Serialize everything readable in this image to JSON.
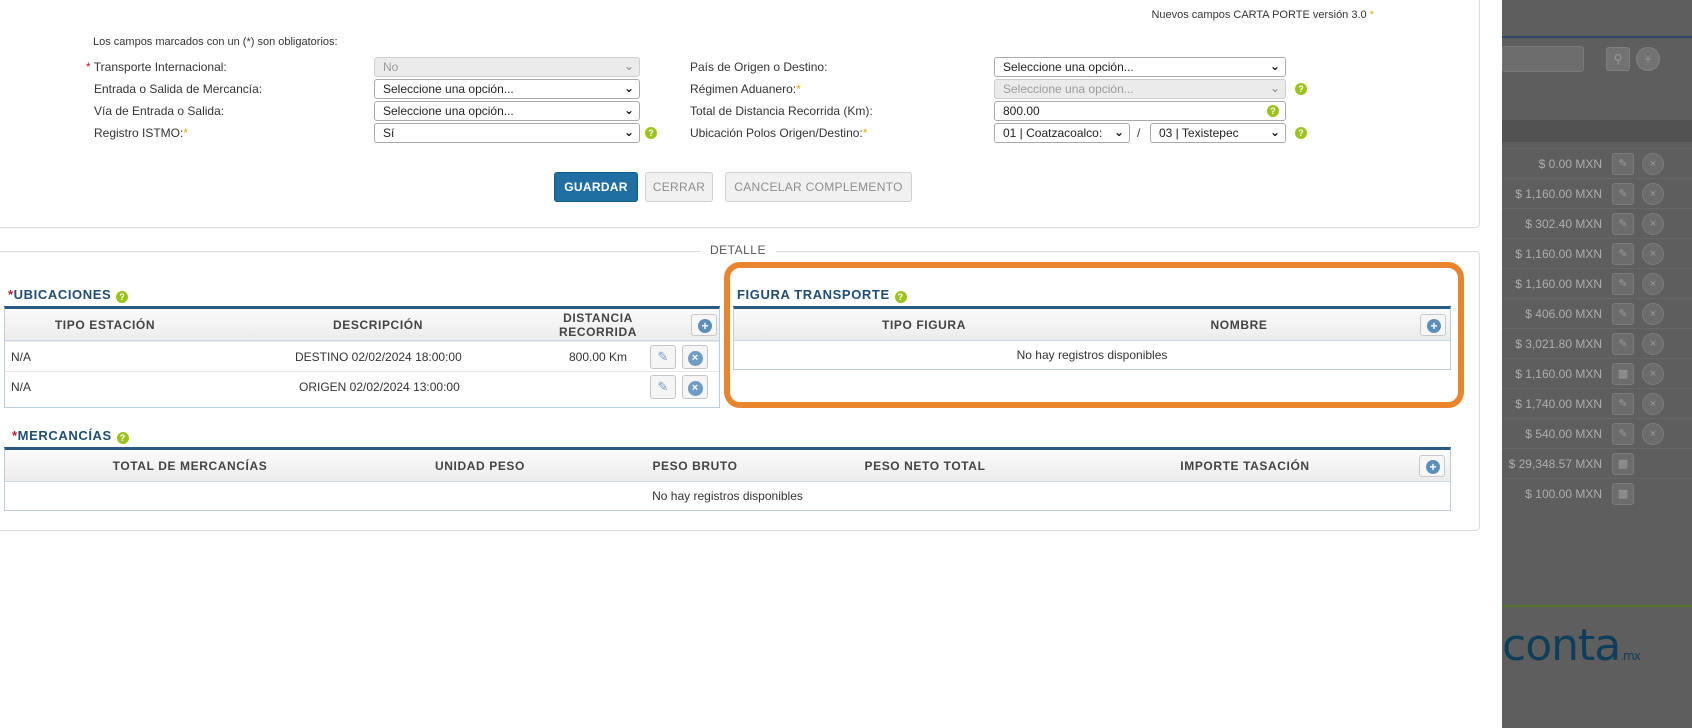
{
  "top": {
    "version_note": "Nuevos campos CARTA PORTE versión 3.0",
    "required_note": "Los campos marcados con un (*) son obligatorios:",
    "fields_left": [
      {
        "label": "Transporte Internacional:",
        "value": "No",
        "required": true,
        "disabled": true
      },
      {
        "label": "Entrada o Salida de Mercancía:",
        "value": "Seleccione una opción...",
        "required": false,
        "disabled": false
      },
      {
        "label": "Vía de Entrada o Salida:",
        "value": "Seleccione una opción...",
        "required": false,
        "disabled": false
      },
      {
        "label": "Registro ISTMO:",
        "value": "Sí",
        "required": true,
        "disabled": false
      }
    ],
    "fields_right": [
      {
        "label": "País de Origen o Destino:",
        "value": "Seleccione una opción...",
        "disabled": false
      },
      {
        "label": "Régimen Aduanero:",
        "value": "Seleccione una opción...",
        "disabled": true
      },
      {
        "label": "Total de Distancia Recorrida (Km):",
        "value": "800.00"
      },
      {
        "label": "Ubicación Polos Origen/Destino:",
        "origen": "01 | Coatzacoalco:",
        "separator": "/",
        "destino": "03 | Texistepec"
      }
    ],
    "buttons": {
      "guardar": "GUARDAR",
      "cerrar": "CERRAR",
      "cancelar": "CANCELAR COMPLEMENTO"
    }
  },
  "detalle": {
    "legend": "DETALLE",
    "ubicaciones": {
      "title": "UBICACIONES",
      "columns": [
        "TIPO ESTACIÓN",
        "DESCRIPCIÓN",
        "DISTANCIA RECORRIDA"
      ],
      "rows": [
        {
          "tipo": "N/A",
          "descripcion": "DESTINO 02/02/2024 18:00:00",
          "distancia": "800.00 Km"
        },
        {
          "tipo": "N/A",
          "descripcion": "ORIGEN 02/02/2024 13:00:00",
          "distancia": ""
        }
      ]
    },
    "figura": {
      "title": "FIGURA TRANSPORTE",
      "columns": [
        "TIPO FIGURA",
        "NOMBRE"
      ],
      "empty": "No hay registros disponibles"
    },
    "mercancias": {
      "title": "MERCANCÍAS",
      "columns": [
        "TOTAL DE MERCANCÍAS",
        "UNIDAD PESO",
        "PESO BRUTO",
        "PESO NETO TOTAL",
        "IMPORTE TASACIÓN"
      ],
      "empty": "No hay registros disponibles"
    }
  },
  "background": {
    "amounts": [
      "$ 0.00 MXN",
      "$ 1,160.00 MXN",
      "$ 302.40 MXN",
      "$ 1,160.00 MXN",
      "$ 1,160.00 MXN",
      "$ 406.00 MXN",
      "$ 3,021.80 MXN",
      "$ 1,160.00 MXN",
      "$ 1,740.00 MXN",
      "$ 540.00 MXN",
      "$ 29,348.57 MXN",
      "$ 100.00 MXN"
    ],
    "logo": "conta",
    "logo_suffix": ".mx"
  },
  "colors": {
    "accent": "#1f6fa3",
    "header_line": "#2a5a7f",
    "help": "#9cc31a",
    "highlight": "#e8852d",
    "required": "#e3ad00"
  }
}
